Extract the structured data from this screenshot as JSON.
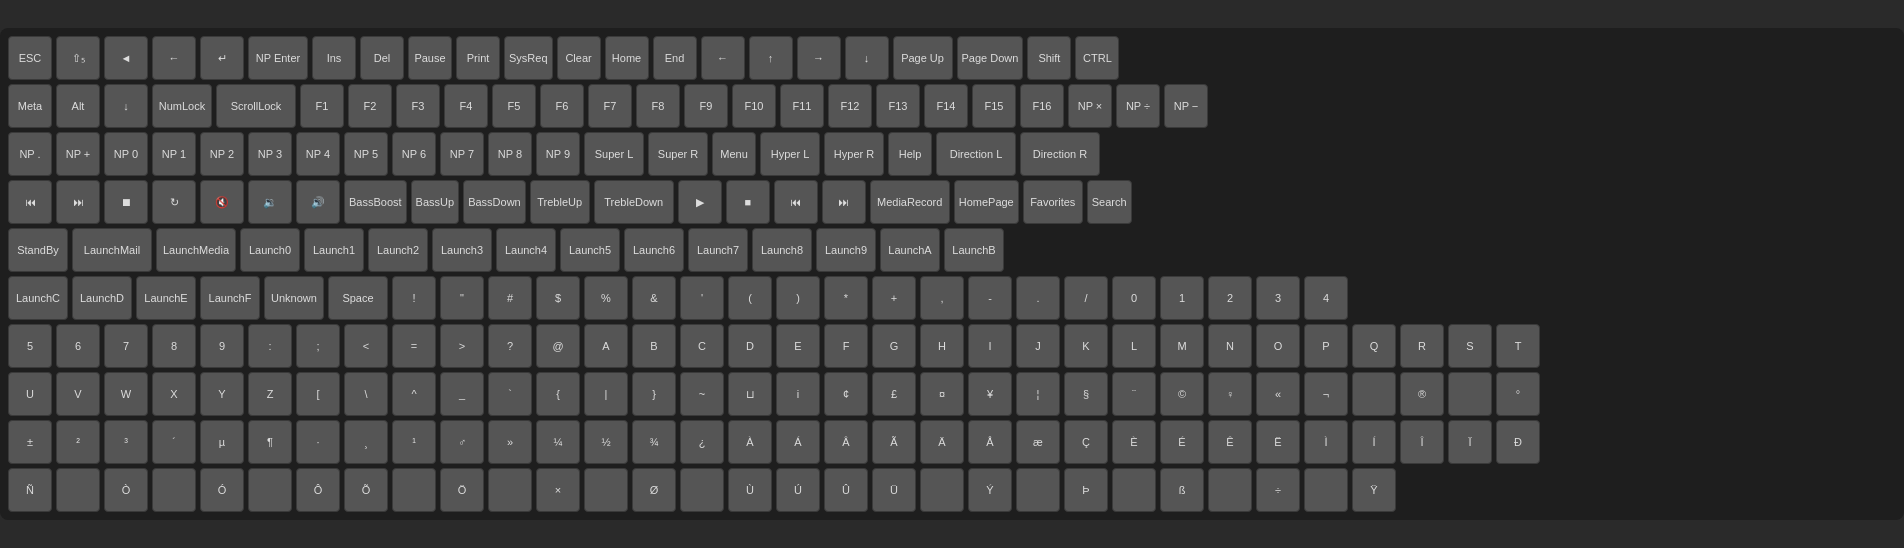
{
  "rows": [
    [
      "ESC",
      "⇧₅",
      "◄",
      "←",
      "↵",
      "NP Enter",
      "Ins",
      "Del",
      "Pause",
      "Print",
      "SysReq",
      "Clear",
      "Home",
      "End",
      "←",
      "↑",
      "→",
      "↓",
      "Page Up",
      "Page Down",
      "Shift",
      "CTRL"
    ],
    [
      "Meta",
      "Alt",
      "↓",
      "NumLock",
      "ScrollLock",
      "F1",
      "F2",
      "F3",
      "F4",
      "F5",
      "F6",
      "F7",
      "F8",
      "F9",
      "F10",
      "F11",
      "F12",
      "F13",
      "F14",
      "F15",
      "F16",
      "NP ×",
      "NP ÷",
      "NP −"
    ],
    [
      "NP .",
      "NP +",
      "NP 0",
      "NP 1",
      "NP 2",
      "NP 3",
      "NP 4",
      "NP 5",
      "NP 6",
      "NP 7",
      "NP 8",
      "NP 9",
      "Super L",
      "Super R",
      "Menu",
      "Hyper L",
      "Hyper R",
      "Help",
      "Direction L",
      "Direction R"
    ],
    [
      "⏮",
      "⏭",
      "⏹",
      "🔄",
      "🔇",
      "🔉",
      "🔊",
      "BassBoost",
      "BassUp",
      "BassDown",
      "TrebleUp",
      "TrebleDown",
      "▶",
      "■",
      "⏮",
      "⏭",
      "MediaRecord",
      "HomePage",
      "Favorites",
      "Search"
    ],
    [
      "StandBy",
      "LaunchMail",
      "LaunchMedia",
      "Launch0",
      "Launch1",
      "Launch2",
      "Launch3",
      "Launch4",
      "Launch5",
      "Launch6",
      "Launch7",
      "Launch8",
      "Launch9",
      "LaunchA",
      "LaunchB"
    ],
    [
      "LaunchC",
      "LaunchD",
      "LaunchE",
      "LaunchF",
      "Unknown",
      "Space",
      "!",
      "\"",
      "#",
      "$",
      "%",
      "&",
      "'",
      "(",
      ")",
      "*",
      "+",
      ",",
      "-",
      ".",
      "/",
      "0",
      "1",
      "2",
      "3",
      "4"
    ],
    [
      "5",
      "6",
      "7",
      "8",
      "9",
      ":",
      ";",
      "<",
      "=",
      ">",
      "?",
      "@",
      "A",
      "B",
      "C",
      "D",
      "E",
      "F",
      "G",
      "H",
      "I",
      "J",
      "K",
      "L",
      "M",
      "N",
      "O",
      "P",
      "Q",
      "R",
      "S",
      "T"
    ],
    [
      "U",
      "V",
      "W",
      "X",
      "Y",
      "Z",
      "[",
      "\\",
      "^",
      "_",
      "`",
      "{",
      "|",
      "}",
      "~",
      "⊔",
      "i",
      "¢",
      "£",
      "¤",
      "¥",
      "¦",
      "§",
      "¨",
      "©",
      "♀",
      "«",
      "¬",
      "­",
      "®",
      "­",
      "°"
    ],
    [
      "±",
      "²",
      "³",
      "´",
      "µ",
      "¶",
      "·",
      "¸",
      "¹",
      "♂",
      "»",
      "¼",
      "½",
      "¾",
      "¿",
      "À",
      "Á",
      "Â",
      "Ã",
      "Ä",
      "Å",
      "æ",
      "Ç",
      "È",
      "É",
      "Ê",
      "Ë",
      "Ì",
      "Í",
      "Î",
      "Ï",
      "Ð"
    ],
    [
      "Ñ",
      "",
      "Ò",
      "",
      "Ó",
      "",
      "Ô",
      "Õ",
      "",
      "Ö",
      "",
      "×",
      "",
      "Ø",
      "",
      "Ù",
      "Ú",
      "Û",
      "Ü",
      "",
      "Ý",
      "",
      "Þ",
      "",
      "ß",
      "",
      "÷",
      "",
      "Ÿ"
    ]
  ]
}
